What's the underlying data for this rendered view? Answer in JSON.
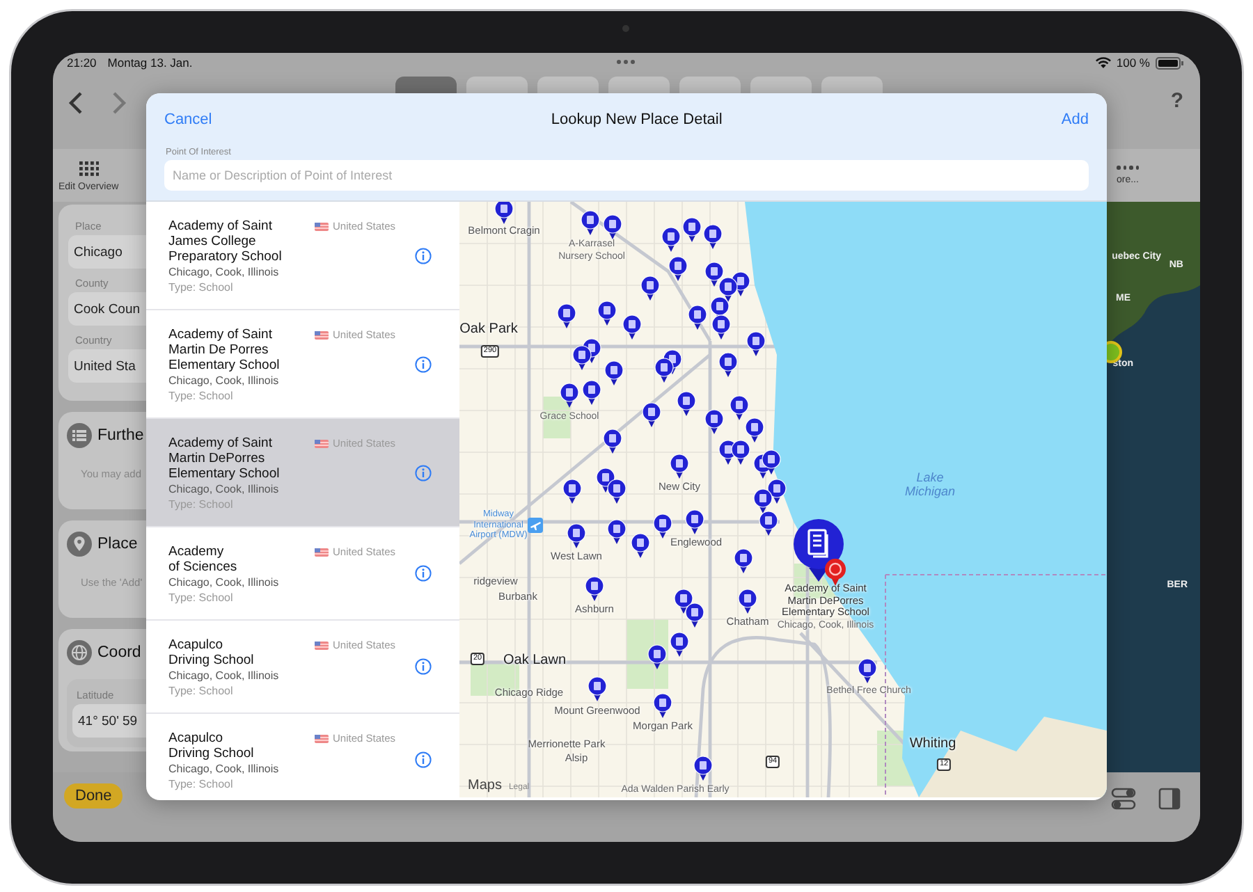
{
  "status_bar": {
    "time": "21:20",
    "date": "Montag 13. Jan.",
    "battery": "100 %"
  },
  "toolbar": {
    "tabs": [
      {
        "selected": true
      },
      {
        "selected": false
      },
      {
        "selected": false
      },
      {
        "selected": false
      },
      {
        "selected": false
      },
      {
        "selected": false
      },
      {
        "selected": false
      }
    ],
    "help": "?"
  },
  "background": {
    "edit_overview": "Edit Overview",
    "more": "ore...",
    "fields": [
      {
        "label": "Place",
        "value": "Chicago"
      },
      {
        "label": "County",
        "value": "Cook Coun"
      },
      {
        "label": "Country",
        "value": "United Sta"
      }
    ],
    "sections": [
      {
        "kind": "list",
        "title": "Furthe",
        "note": "You may add"
      },
      {
        "kind": "pin",
        "title": "Place",
        "note": "Use the 'Add'"
      },
      {
        "kind": "globe",
        "title": "Coord",
        "field_label": "Latitude",
        "field_value": "41° 50' 59"
      }
    ],
    "satellite_labels": [
      "uebec City",
      "NB",
      "ME",
      "ston",
      "BER"
    ],
    "done": "Done"
  },
  "sheet": {
    "cancel": "Cancel",
    "title": "Lookup New Place Detail",
    "add": "Add",
    "field": {
      "label": "Point Of Interest",
      "placeholder": "Name or Description of Point of Interest"
    },
    "results": [
      {
        "title": "Academy of Saint\nJames College\nPreparatory School",
        "country": "United States",
        "location": "Chicago, Cook, Illinois",
        "type": "Type: School",
        "selected": false
      },
      {
        "title": "Academy of Saint\nMartin De Porres\nElementary School",
        "country": "United States",
        "location": "Chicago, Cook, Illinois",
        "type": "Type: School",
        "selected": false
      },
      {
        "title": "Academy of Saint\nMartin DePorres\nElementary School",
        "country": "United States",
        "location": "Chicago, Cook, Illinois",
        "type": "Type: School",
        "selected": true
      },
      {
        "title": "Academy\nof Sciences",
        "country": "United States",
        "location": "Chicago, Cook, Illinois",
        "type": "Type: School",
        "selected": false
      },
      {
        "title": "Acapulco\nDriving School",
        "country": "United States",
        "location": "Chicago, Cook, Illinois",
        "type": "Type: School",
        "selected": false
      },
      {
        "title": "Acapulco\nDriving School",
        "country": "United States",
        "location": "Chicago, Cook, Illinois",
        "type": "Type: School",
        "selected": false
      }
    ],
    "map": {
      "labels": [
        {
          "kind": "place",
          "text": "Belmont Cragin"
        },
        {
          "kind": "poi",
          "text": "A-Karrasel\nNursery School"
        },
        {
          "kind": "city",
          "text": "Oak Park"
        },
        {
          "kind": "poi",
          "text": "Grace School"
        },
        {
          "kind": "place",
          "text": "New City"
        },
        {
          "kind": "water",
          "text": "Lake\nMichigan"
        },
        {
          "kind": "airport",
          "text": "Midway\nInternational\nAirport (MDW)"
        },
        {
          "kind": "place",
          "text": "West Lawn"
        },
        {
          "kind": "place",
          "text": "Englewood"
        },
        {
          "kind": "place",
          "text": "ridgeview"
        },
        {
          "kind": "place",
          "text": "Burbank"
        },
        {
          "kind": "place",
          "text": "Ashburn"
        },
        {
          "kind": "place",
          "text": "Chatham"
        },
        {
          "kind": "selected",
          "text": "Academy of Saint\nMartin DePorres\nElementary School"
        },
        {
          "kind": "poi",
          "text": "Chicago, Cook, Illinois"
        },
        {
          "kind": "city",
          "text": "Oak Lawn"
        },
        {
          "kind": "place",
          "text": "Chicago Ridge"
        },
        {
          "kind": "poi",
          "text": "Bethel Free Church"
        },
        {
          "kind": "place",
          "text": "Mount Greenwood"
        },
        {
          "kind": "place",
          "text": "Morgan Park"
        },
        {
          "kind": "place",
          "text": "Merrionette Park"
        },
        {
          "kind": "place",
          "text": "Alsip"
        },
        {
          "kind": "city",
          "text": "Whiting"
        },
        {
          "kind": "poi",
          "text": "Ada Walden Parish Early"
        },
        {
          "kind": "shield",
          "text": "290"
        },
        {
          "kind": "shield",
          "text": "20"
        },
        {
          "kind": "shield",
          "text": "12"
        },
        {
          "kind": "shield",
          "text": "94"
        }
      ],
      "attribution": "Maps",
      "legal": "Legal"
    }
  }
}
